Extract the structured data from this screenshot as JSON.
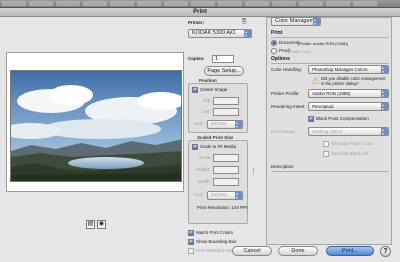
{
  "title": "Print",
  "printer": {
    "label": "Printer:",
    "selected": "KODAK 5300 AiO",
    "copies_label": "Copies:",
    "copies_value": "1",
    "page_setup_label": "Page Setup..."
  },
  "position": {
    "title": "Position",
    "center_image_label": "Center Image",
    "top_label": "Top:",
    "left_label": "Left:",
    "unit_label": "Unit:",
    "unit_value": "inches"
  },
  "scaled_print_size": {
    "title": "Scaled Print Size",
    "scale_to_fit_label": "Scale to Fit Media",
    "scale_label": "Scale:",
    "height_label": "Height:",
    "width_label": "Width:",
    "unit_label": "Unit:",
    "unit_value": "inches",
    "print_resolution": "Print Resolution: 144 PPI"
  },
  "options_left": {
    "match_print_colors": "Match Print Colors",
    "show_bounding_box": "Show Bounding Box",
    "print_selected_area": "Print Selected Area"
  },
  "right_panel": {
    "mode_select": "Color Management",
    "print_heading": "Print",
    "document_label": "Document",
    "document_profile": "(Profile: Adobe RGB (1998))",
    "proof_label": "Proof",
    "proof_profile": "(Profile: N/A)",
    "options_heading": "Options",
    "color_handling_label": "Color Handling:",
    "color_handling_value": "Photoshop Manages Colors",
    "disable_note": "Did you disable color management in the printer dialog?",
    "printer_profile_label": "Printer Profile:",
    "printer_profile_value": "Adobe RGB (1998)",
    "rendering_intent_label": "Rendering Intent:",
    "rendering_intent_value": "Perceptual",
    "black_point_label": "Black Point Compensation",
    "proof_setup_label": "Proof Setup:",
    "proof_setup_value": "Working CMYK",
    "simulate_paper_label": "Simulate Paper Color",
    "simulate_black_label": "Simulate Black Ink",
    "description_heading": "Description"
  },
  "buttons": {
    "cancel": "Cancel",
    "done": "Done",
    "print": "Print...",
    "help": "?"
  },
  "colors": {
    "accent": "#3e70c7",
    "dialog_bg": "#e6e6e6"
  }
}
